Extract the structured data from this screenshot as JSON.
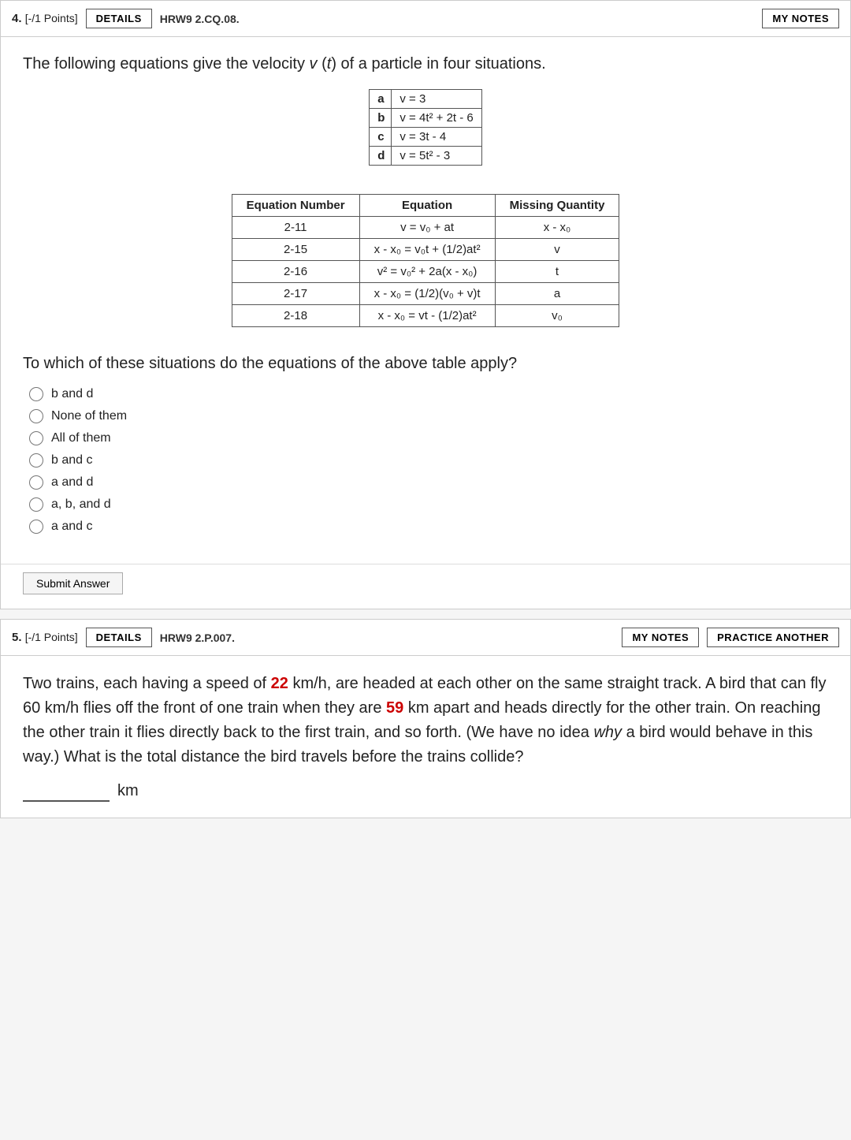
{
  "q4": {
    "header": {
      "number": "4.",
      "points": "[-/1 Points]",
      "details_label": "DETAILS",
      "code": "HRW9 2.CQ.08.",
      "mynotes_label": "MY NOTES"
    },
    "intro_text": "The following equations give the velocity v (t) of a particle in four situations.",
    "small_table": {
      "rows": [
        {
          "letter": "a",
          "eq": "v = 3"
        },
        {
          "letter": "b",
          "eq": "v = 4t² + 2t - 6"
        },
        {
          "letter": "c",
          "eq": "v = 3t - 4"
        },
        {
          "letter": "d",
          "eq": "v = 5t² - 3"
        }
      ]
    },
    "kinematics_table": {
      "headers": [
        "Equation Number",
        "Equation",
        "Missing Quantity"
      ],
      "rows": [
        {
          "num": "2-11",
          "eq": "v = v₀ + at",
          "missing": "x - x₀"
        },
        {
          "num": "2-15",
          "eq": "x - x₀ = v₀t + (1/2)at²",
          "missing": "v"
        },
        {
          "num": "2-16",
          "eq": "v² = v₀² + 2a(x - x₀)",
          "missing": "t"
        },
        {
          "num": "2-17",
          "eq": "x - x₀ = (1/2)(v₀ + v)t",
          "missing": "a"
        },
        {
          "num": "2-18",
          "eq": "x - x₀ = vt - (1/2)at²",
          "missing": "v₀"
        }
      ]
    },
    "sub_question": "To which of these situations do the equations of the above table apply?",
    "options": [
      "b and d",
      "None of them",
      "All of them",
      "b and c",
      "a and d",
      "a, b, and d",
      "a and c"
    ],
    "submit_label": "Submit Answer"
  },
  "q5": {
    "header": {
      "number": "5.",
      "points": "[-/1 Points]",
      "details_label": "DETAILS",
      "code": "HRW9 2.P.007.",
      "mynotes_label": "MY NOTES",
      "practice_label": "PRACTICE ANOTHER"
    },
    "text_part1": "Two trains, each having a speed of ",
    "speed_highlight": "22",
    "text_part2": " km/h, are headed at each other on the same straight track. A bird that can fly 60 km/h flies off the front of one train when they are ",
    "distance_highlight": "59",
    "text_part3": " km apart and heads directly for the other train. On reaching the other train it flies directly back to the first train, and so forth. (We have no idea ",
    "italic_word": "why",
    "text_part4": " a bird would behave in this way.) What is the total distance the bird travels before the trains collide?",
    "answer_placeholder": "",
    "unit": "km"
  }
}
